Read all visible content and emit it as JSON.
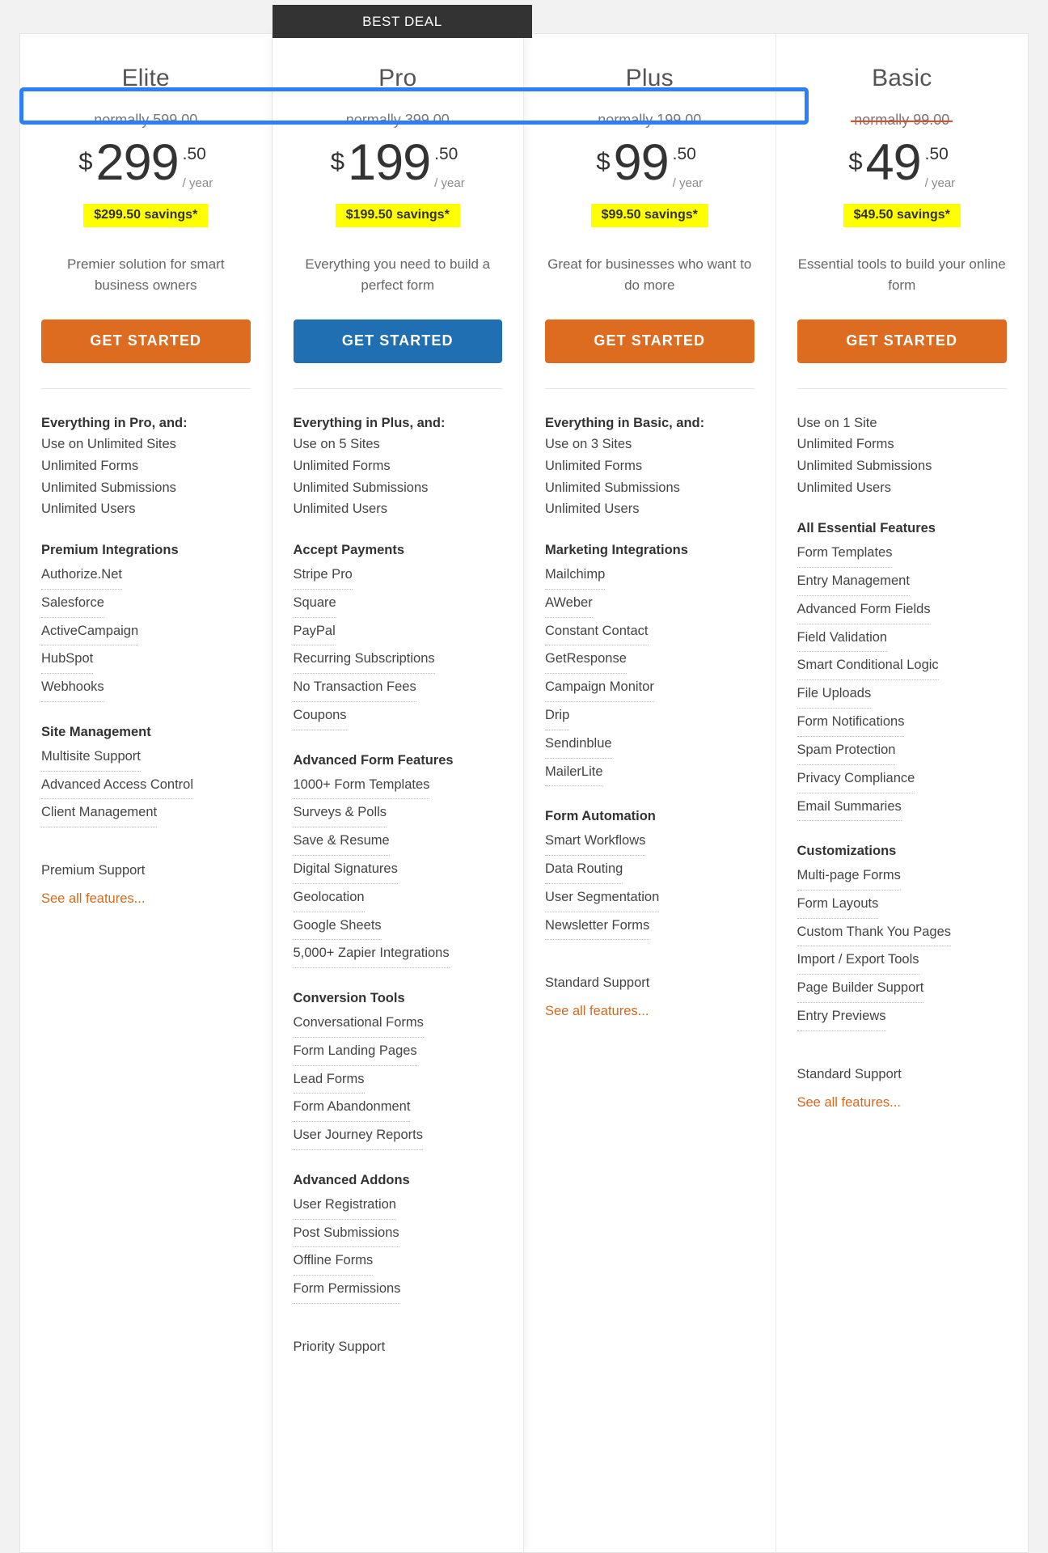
{
  "badge": {
    "label": "BEST DEAL"
  },
  "currency": "$",
  "per_period": "/ year",
  "cta_label": "GET STARTED",
  "see_all_label": "See all features...",
  "colors": {
    "badge_bg": "#333333",
    "cta_orange": "#dd6b20",
    "cta_blue": "#1f6fb2",
    "savings_bg": "#ffff00",
    "strike_red": "#e04b2a",
    "link_orange": "#d2691e",
    "highlight_blue": "#2d7ff9"
  },
  "plans": [
    {
      "name": "Elite",
      "normally": "normally 599.00",
      "amount": "299",
      "cents": ".50",
      "savings": "$299.50 savings*",
      "blurb": "Premier solution for smart business owners",
      "cta_style": "orange",
      "featured": false,
      "groups": [
        {
          "title": "Everything in Pro, and:",
          "plain_items": [
            "Use on Unlimited Sites",
            "Unlimited Forms",
            "Unlimited Submissions",
            "Unlimited Users"
          ],
          "link_items": []
        },
        {
          "title": "Premium Integrations",
          "plain_items": [],
          "link_items": [
            "Authorize.Net",
            "Salesforce",
            "ActiveCampaign",
            "HubSpot",
            "Webhooks"
          ]
        },
        {
          "title": "Site Management",
          "plain_items": [],
          "link_items": [
            "Multisite Support",
            "Advanced Access Control",
            "Client Management"
          ]
        }
      ],
      "support": "Premium Support"
    },
    {
      "name": "Pro",
      "normally": "normally 399.00",
      "amount": "199",
      "cents": ".50",
      "savings": "$199.50 savings*",
      "blurb": "Everything you need to build a perfect form",
      "cta_style": "blue",
      "featured": true,
      "groups": [
        {
          "title": "Everything in Plus, and:",
          "plain_items": [
            "Use on 5 Sites",
            "Unlimited Forms",
            "Unlimited Submissions",
            "Unlimited Users"
          ],
          "link_items": []
        },
        {
          "title": "Accept Payments",
          "plain_items": [],
          "link_items": [
            "Stripe Pro",
            "Square",
            "PayPal",
            "Recurring Subscriptions",
            "No Transaction Fees",
            "Coupons"
          ]
        },
        {
          "title": "Advanced Form Features",
          "plain_items": [],
          "link_items": [
            "1000+ Form Templates",
            "Surveys & Polls",
            "Save & Resume",
            "Digital Signatures",
            "Geolocation",
            "Google Sheets",
            "5,000+ Zapier Integrations"
          ]
        },
        {
          "title": "Conversion Tools",
          "plain_items": [],
          "link_items": [
            "Conversational Forms",
            "Form Landing Pages",
            "Lead Forms",
            "Form Abandonment",
            "User Journey Reports"
          ]
        },
        {
          "title": "Advanced Addons",
          "plain_items": [],
          "link_items": [
            "User Registration",
            "Post Submissions",
            "Offline Forms",
            "Form Permissions"
          ]
        }
      ],
      "support": "Priority Support"
    },
    {
      "name": "Plus",
      "normally": "normally 199.00",
      "amount": "99",
      "cents": ".50",
      "savings": "$99.50 savings*",
      "blurb": "Great for businesses who want to do more",
      "cta_style": "orange",
      "featured": false,
      "groups": [
        {
          "title": "Everything in Basic, and:",
          "plain_items": [
            "Use on 3 Sites",
            "Unlimited Forms",
            "Unlimited Submissions",
            "Unlimited Users"
          ],
          "link_items": []
        },
        {
          "title": "Marketing Integrations",
          "plain_items": [],
          "link_items": [
            "Mailchimp",
            "AWeber",
            "Constant Contact",
            "GetResponse",
            "Campaign Monitor",
            "Drip",
            "Sendinblue",
            "MailerLite"
          ]
        },
        {
          "title": "Form Automation",
          "plain_items": [],
          "link_items": [
            "Smart Workflows",
            "Data Routing",
            "User Segmentation",
            "Newsletter Forms"
          ]
        }
      ],
      "support": "Standard Support"
    },
    {
      "name": "Basic",
      "normally": "normally 99.00",
      "amount": "49",
      "cents": ".50",
      "savings": "$49.50 savings*",
      "blurb": "Essential tools to build your online form",
      "cta_style": "orange",
      "featured": false,
      "groups": [
        {
          "title": "",
          "plain_items": [
            "Use on 1 Site",
            "Unlimited Forms",
            "Unlimited Submissions",
            "Unlimited Users"
          ],
          "link_items": []
        },
        {
          "title": "All Essential Features",
          "plain_items": [],
          "link_items": [
            "Form Templates",
            "Entry Management",
            "Advanced Form Fields",
            "Field Validation",
            "Smart Conditional Logic",
            "File Uploads",
            "Form Notifications",
            "Spam Protection",
            "Privacy Compliance",
            "Email Summaries"
          ]
        },
        {
          "title": "Customizations",
          "plain_items": [],
          "link_items": [
            "Multi-page Forms",
            "Form Layouts",
            "Custom Thank You Pages",
            "Import / Export Tools",
            "Page Builder Support",
            "Entry Previews"
          ]
        }
      ],
      "support": "Standard Support"
    }
  ]
}
